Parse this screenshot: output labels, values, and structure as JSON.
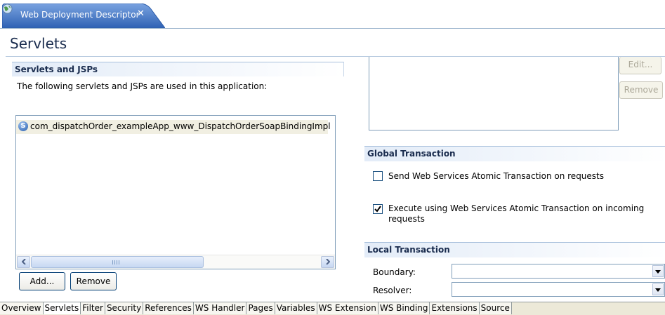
{
  "editor": {
    "tab_title": "Web Deployment Descriptor",
    "tab_icon": "globe-icon",
    "close_icon": "close-icon"
  },
  "page": {
    "title": "Servlets"
  },
  "servlets_section": {
    "title": "Servlets and JSPs",
    "description": "The following servlets and JSPs are used in this application:",
    "items": [
      {
        "icon": "servlet-s-icon",
        "icon_glyph": "S",
        "label": "com_dispatchOrder_exampleApp_www_DispatchOrderSoapBindingImpl"
      }
    ],
    "add_label": "Add...",
    "remove_label": "Remove"
  },
  "right_panel": {
    "edit_label": "Edit...",
    "remove_label": "Remove"
  },
  "global_transaction": {
    "title": "Global Transaction",
    "send_label": "Send Web Services Atomic Transaction on requests",
    "send_checked": false,
    "execute_label": "Execute using Web Services Atomic Transaction on incoming requests",
    "execute_checked": true
  },
  "local_transaction": {
    "title": "Local Transaction",
    "boundary_label": "Boundary:",
    "boundary_value": "",
    "resolver_label": "Resolver:",
    "resolver_value": ""
  },
  "page_tabs": [
    "Overview",
    "Servlets",
    "Filter",
    "Security",
    "References",
    "WS Handler",
    "Pages",
    "Variables",
    "WS Extension",
    "WS Binding",
    "Extensions",
    "Source"
  ],
  "active_tab": "Servlets",
  "colors": {
    "tab_blue": "#3a6fc2",
    "section_title": "#1a2c4e",
    "border": "#7f9db9"
  }
}
